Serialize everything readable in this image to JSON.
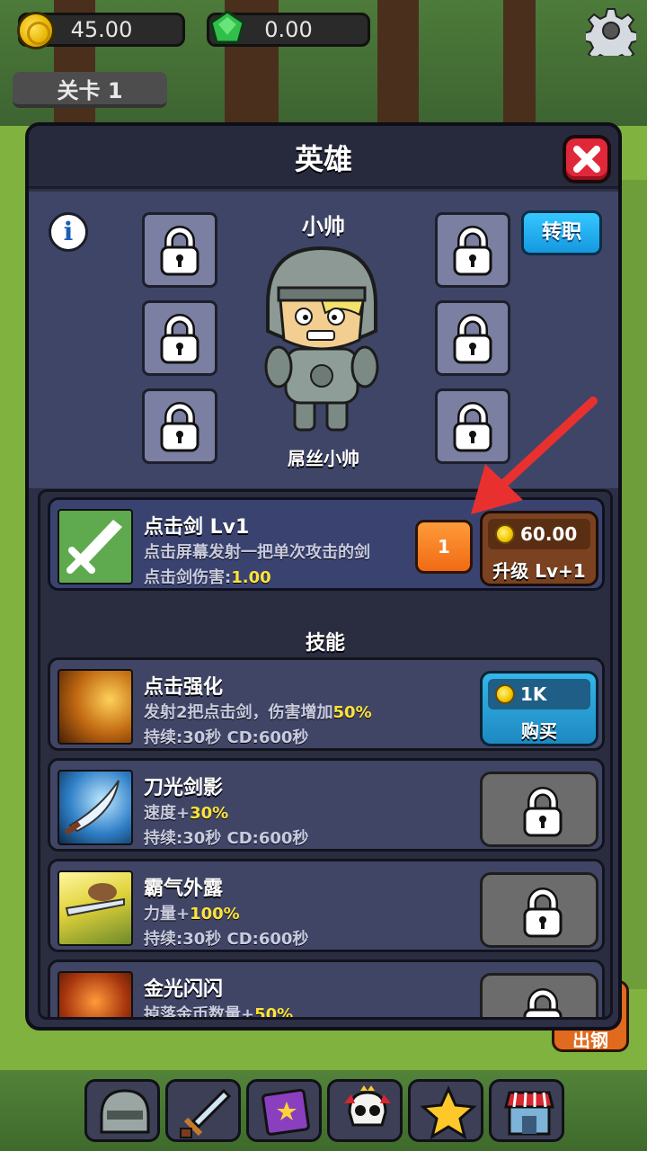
{
  "topbar": {
    "gold": "45.00",
    "gems": "0.00",
    "stage": "关卡 1"
  },
  "panel": {
    "title": "英雄",
    "transfer_label": "转职",
    "info_label": "i",
    "hero": {
      "name": "小帅",
      "subtitle": "屌丝小帅"
    },
    "weapon": {
      "title": "点击剑 Lv1",
      "desc": "点击屏幕发射一把单次攻击的剑",
      "damage_label": "点击剑伤害:",
      "damage_value": "1.00",
      "qty": "1",
      "price": "60.00",
      "upgrade_label": "升级 Lv+1"
    },
    "skills_header": "技能",
    "skills": [
      {
        "title": "点击强化",
        "line1_pre": "发射2把点击剑，伤害增加",
        "line1_hl": "50%",
        "line2": "持续:30秒 CD:600秒",
        "price": "1K",
        "buy_label": "购买",
        "locked": false
      },
      {
        "title": "刀光剑影",
        "line1_pre": "速度+",
        "line1_hl": "30%",
        "line2": "持续:30秒 CD:600秒",
        "locked": true
      },
      {
        "title": "霸气外露",
        "line1_pre": "力量+",
        "line1_hl": "100%",
        "line2": "持续:30秒 CD:600秒",
        "locked": true
      },
      {
        "title": "金光闪闪",
        "line1_pre": "掉落金币数量+",
        "line1_hl": "50%",
        "locked": true
      }
    ]
  },
  "side": {
    "exit_label": "出钢"
  },
  "nav": {
    "items": [
      "hero",
      "weapon",
      "book",
      "boss",
      "star",
      "shop"
    ]
  },
  "colors": {
    "panel_bg": "#2c2f45",
    "highlight": "#ffe33a",
    "arrow": "#e8312f",
    "close": "#e0283a",
    "transfer": "#1598e0"
  }
}
